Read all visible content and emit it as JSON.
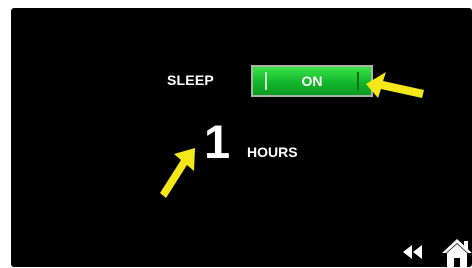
{
  "sleep": {
    "label": "SLEEP",
    "toggle_state": "ON"
  },
  "hours": {
    "value": "1",
    "unit": "HOURS"
  },
  "nav": {
    "rewind_icon": "rewind-icon",
    "home_icon": "home-icon"
  },
  "colors": {
    "screen_background": "#000000",
    "toggle_green": "#12b62a",
    "annotation_arrow": "#f4e81b",
    "text": "#ffffff"
  }
}
